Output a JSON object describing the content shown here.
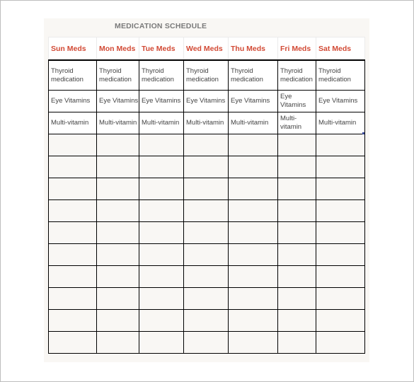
{
  "document": {
    "title": "MEDICATION SCHEDULE",
    "header_color": "#d24a35",
    "columns": [
      "Sun Meds",
      "Mon Meds",
      "Tue Meds",
      "Wed Meds",
      "Thu Meds",
      "Fri Meds",
      "Sat Meds"
    ],
    "rows": [
      [
        "Thyroid medication",
        "Thyroid medication",
        "Thyroid medication",
        "Thyroid medication",
        "Thyroid medication",
        "Thyroid medication",
        "Thyroid medication"
      ],
      [
        "Eye Vitamins",
        "Eye Vitamins",
        "Eye Vitamins",
        "Eye Vitamins",
        "Eye Vitamins",
        "Eye Vitamins",
        "Eye Vitamins"
      ],
      [
        "Multi-vitamin",
        "Multi-vitamin",
        "Multi-vitamin",
        "Multi-vitamin",
        "Multi-vitamin",
        "Multi-vitamin",
        "Multi-vitamin"
      ]
    ],
    "blank_row_count": 10
  }
}
